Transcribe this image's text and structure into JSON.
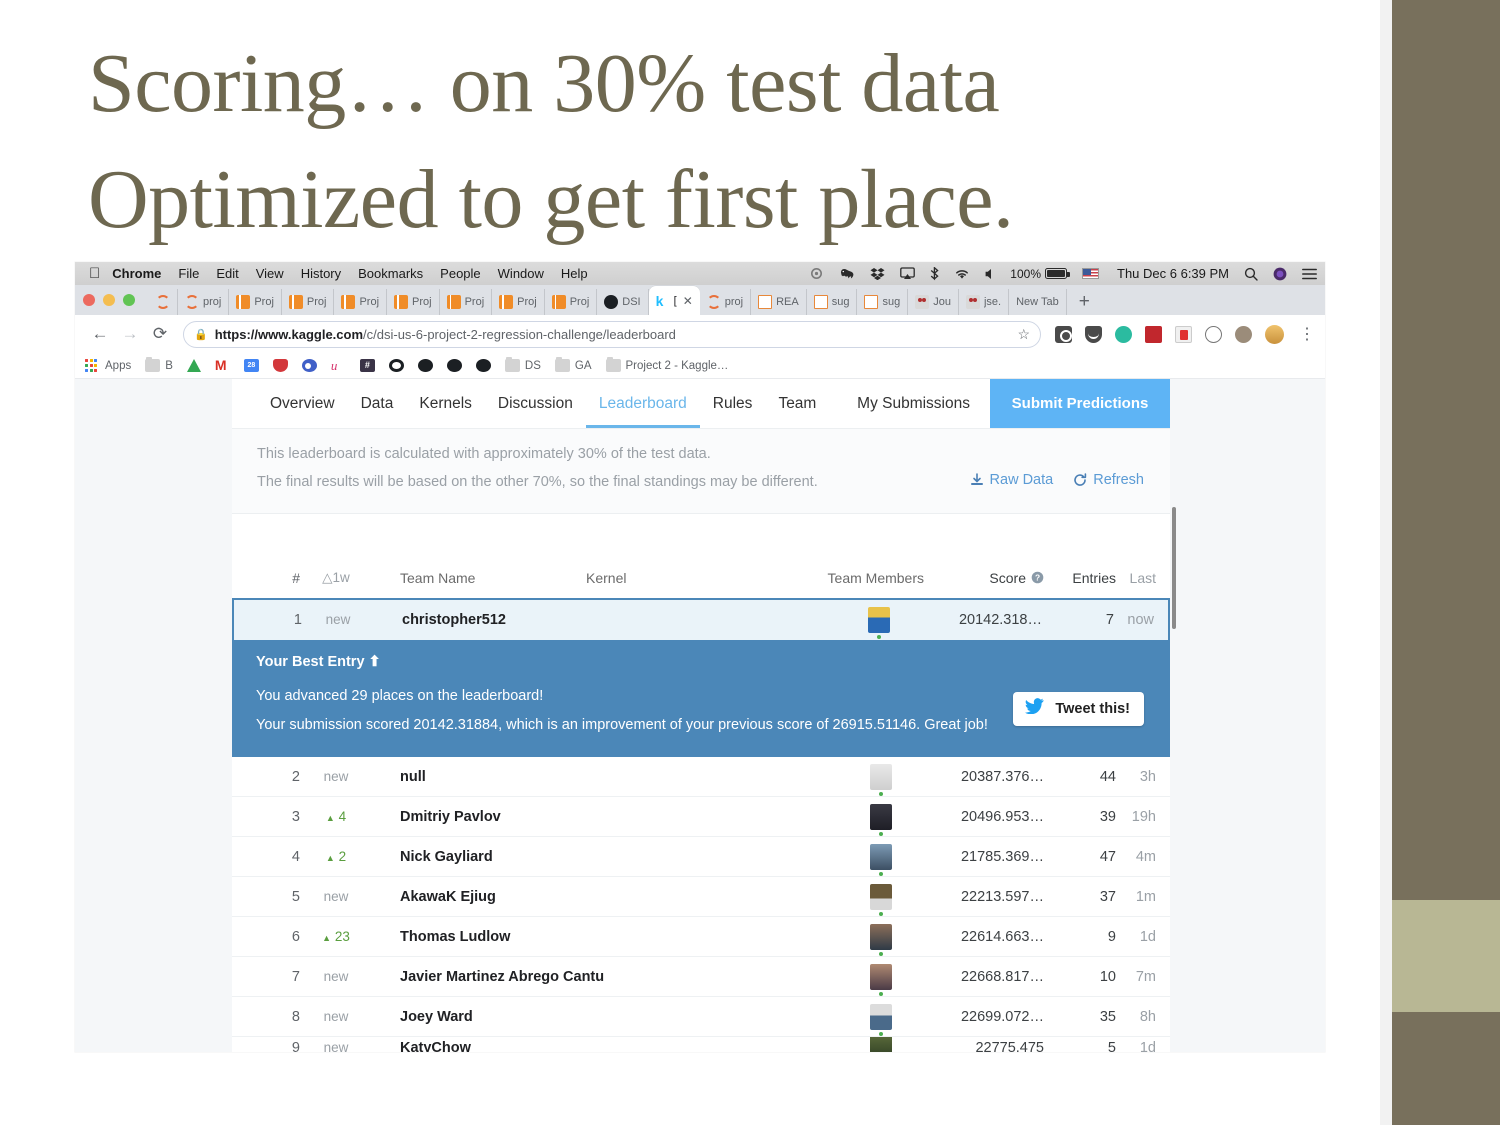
{
  "slide": {
    "title": "Scoring… on 30% test data\nOptimized to get first place."
  },
  "colors": {
    "title_olive": "#6e6850",
    "sidebar_dark": "#78705c",
    "sidebar_light": "#b8b794",
    "kaggle_blue": "#4b87b8",
    "submit_blue": "#5eb4f5",
    "link_blue": "#5b9bd5",
    "up_green": "#5a9e3f"
  },
  "macbar": {
    "apple_icon": "apple-icon",
    "menus": [
      "Chrome",
      "File",
      "Edit",
      "View",
      "History",
      "Bookmarks",
      "People",
      "Window",
      "Help"
    ],
    "status_icons": [
      "creative-cloud-icon",
      "evernote-icon",
      "dropbox-icon",
      "airplay-icon",
      "bluetooth-icon",
      "wifi-icon",
      "volume-icon"
    ],
    "battery": "100%",
    "battery_icon": "battery-charging-icon",
    "flag_icon": "us-flag-icon",
    "clock": "Thu Dec 6  6:39 PM",
    "right_icons": [
      "search-icon",
      "siri-icon",
      "notification-center-icon"
    ]
  },
  "browser": {
    "tabs": [
      {
        "label": "proj",
        "icon": "arc-icon",
        "active": false
      },
      {
        "label": "Proj",
        "icon": "book-icon",
        "active": false
      },
      {
        "label": "Proj",
        "icon": "book-icon",
        "active": false
      },
      {
        "label": "Proj",
        "icon": "book-icon",
        "active": false
      },
      {
        "label": "Proj",
        "icon": "book-icon",
        "active": false
      },
      {
        "label": "Proj",
        "icon": "book-icon",
        "active": false
      },
      {
        "label": "Proj",
        "icon": "book-icon",
        "active": false
      },
      {
        "label": "Proj",
        "icon": "book-icon",
        "active": false
      },
      {
        "label": "DSI",
        "icon": "github-icon",
        "active": false
      },
      {
        "label": "[",
        "icon": "kaggle-icon",
        "active": true
      },
      {
        "label": "proj",
        "icon": "arc-icon",
        "active": false
      },
      {
        "label": "REA",
        "icon": "doc-icon",
        "active": false
      },
      {
        "label": "sug",
        "icon": "doc-icon",
        "active": false
      },
      {
        "label": "sug",
        "icon": "doc-icon",
        "active": false
      },
      {
        "label": "Jou",
        "icon": "journal-icon",
        "active": false
      },
      {
        "label": "jse.",
        "icon": "journal-icon",
        "active": false
      },
      {
        "label": "New Tab",
        "icon": "none",
        "active": false
      }
    ],
    "new_tab_label": "+",
    "close_tab_label": "✕",
    "nav": {
      "back": "←",
      "forward": "→",
      "reload": "⟳"
    },
    "url": {
      "lock_icon": "lock-icon",
      "domain": "https://www.kaggle.com",
      "path": "/c/dsi-us-6-project-2-regression-challenge/leaderboard",
      "star_icon": "star-icon"
    },
    "extensions": [
      "camera-icon",
      "pocket-icon",
      "evernote-green-icon",
      "red-square-icon",
      "white-ext-icon",
      "circle-icon",
      "face-icon",
      "profile-avatar"
    ],
    "menu_icon": "three-dot-menu-icon",
    "bookmarks": [
      {
        "label": "Apps",
        "icon": "apps-grid-icon"
      },
      {
        "label": "B",
        "icon": "folder-icon"
      },
      {
        "label": "",
        "icon": "google-drive-icon"
      },
      {
        "label": "",
        "icon": "gmail-icon"
      },
      {
        "label": "",
        "icon": "calendar-icon"
      },
      {
        "label": "",
        "icon": "pocket-icon"
      },
      {
        "label": "",
        "icon": "eye-icon"
      },
      {
        "label": "",
        "icon": "u-icon"
      },
      {
        "label": "",
        "icon": "hash-icon"
      },
      {
        "label": "",
        "icon": "github-white-icon"
      },
      {
        "label": "",
        "icon": "github-black-icon"
      },
      {
        "label": "",
        "icon": "github-black-icon"
      },
      {
        "label": "",
        "icon": "github-black-icon"
      },
      {
        "label": "DS",
        "icon": "folder-icon"
      },
      {
        "label": "GA",
        "icon": "folder-icon"
      },
      {
        "label": "Project 2 - Kaggle…",
        "icon": "folder-icon"
      }
    ]
  },
  "kaggle": {
    "nav_items": [
      "Overview",
      "Data",
      "Kernels",
      "Discussion",
      "Leaderboard",
      "Rules",
      "Team"
    ],
    "active_nav": "Leaderboard",
    "my_submissions": "My Submissions",
    "submit_predictions": "Submit Predictions",
    "info_line_1": "This leaderboard is calculated with approximately 30% of the test data.",
    "info_line_2": "The final results will be based on the other 70%, so the final standings may be different.",
    "raw_data": "Raw Data",
    "raw_data_icon": "download-icon",
    "refresh": "Refresh",
    "refresh_icon": "refresh-icon",
    "headers": {
      "rank": "#",
      "delta": "△1w",
      "team_name": "Team Name",
      "kernel": "Kernel",
      "team_members": "Team Members",
      "score": "Score",
      "score_help_icon": "help-icon",
      "entries": "Entries",
      "last": "Last"
    },
    "rows": [
      {
        "rank": "1",
        "delta": "new",
        "delta_up": false,
        "team": "christopher512",
        "score": "20142.318…",
        "entries": "7",
        "last": "now",
        "highlight": true
      },
      {
        "rank": "2",
        "delta": "new",
        "delta_up": false,
        "team": "null",
        "score": "20387.376…",
        "entries": "44",
        "last": "3h",
        "highlight": false
      },
      {
        "rank": "3",
        "delta": "4",
        "delta_up": true,
        "team": "Dmitriy Pavlov",
        "score": "20496.953…",
        "entries": "39",
        "last": "19h",
        "highlight": false
      },
      {
        "rank": "4",
        "delta": "2",
        "delta_up": true,
        "team": "Nick Gayliard",
        "score": "21785.369…",
        "entries": "47",
        "last": "4m",
        "highlight": false
      },
      {
        "rank": "5",
        "delta": "new",
        "delta_up": false,
        "team": "AkawaK Ejiug",
        "score": "22213.597…",
        "entries": "37",
        "last": "1m",
        "highlight": false
      },
      {
        "rank": "6",
        "delta": "23",
        "delta_up": true,
        "team": "Thomas Ludlow",
        "score": "22614.663…",
        "entries": "9",
        "last": "1d",
        "highlight": false
      },
      {
        "rank": "7",
        "delta": "new",
        "delta_up": false,
        "team": "Javier Martinez Abrego Cantu",
        "score": "22668.817…",
        "entries": "10",
        "last": "7m",
        "highlight": false
      },
      {
        "rank": "8",
        "delta": "new",
        "delta_up": false,
        "team": "Joey Ward",
        "score": "22699.072…",
        "entries": "35",
        "last": "8h",
        "highlight": false
      },
      {
        "rank": "9",
        "delta": "new",
        "delta_up": false,
        "team": "KatyChow",
        "score": "22775.475",
        "entries": "5",
        "last": "1d",
        "highlight": false
      }
    ],
    "best_entry": {
      "title": "Your Best Entry ⬆",
      "line1": "You advanced 29 places on the leaderboard!",
      "line2": "Your submission scored 20142.31884, which is an improvement of your previous score of 26915.51146. Great job!",
      "tweet_label": "Tweet this!",
      "tweet_icon": "twitter-bird-icon"
    }
  }
}
